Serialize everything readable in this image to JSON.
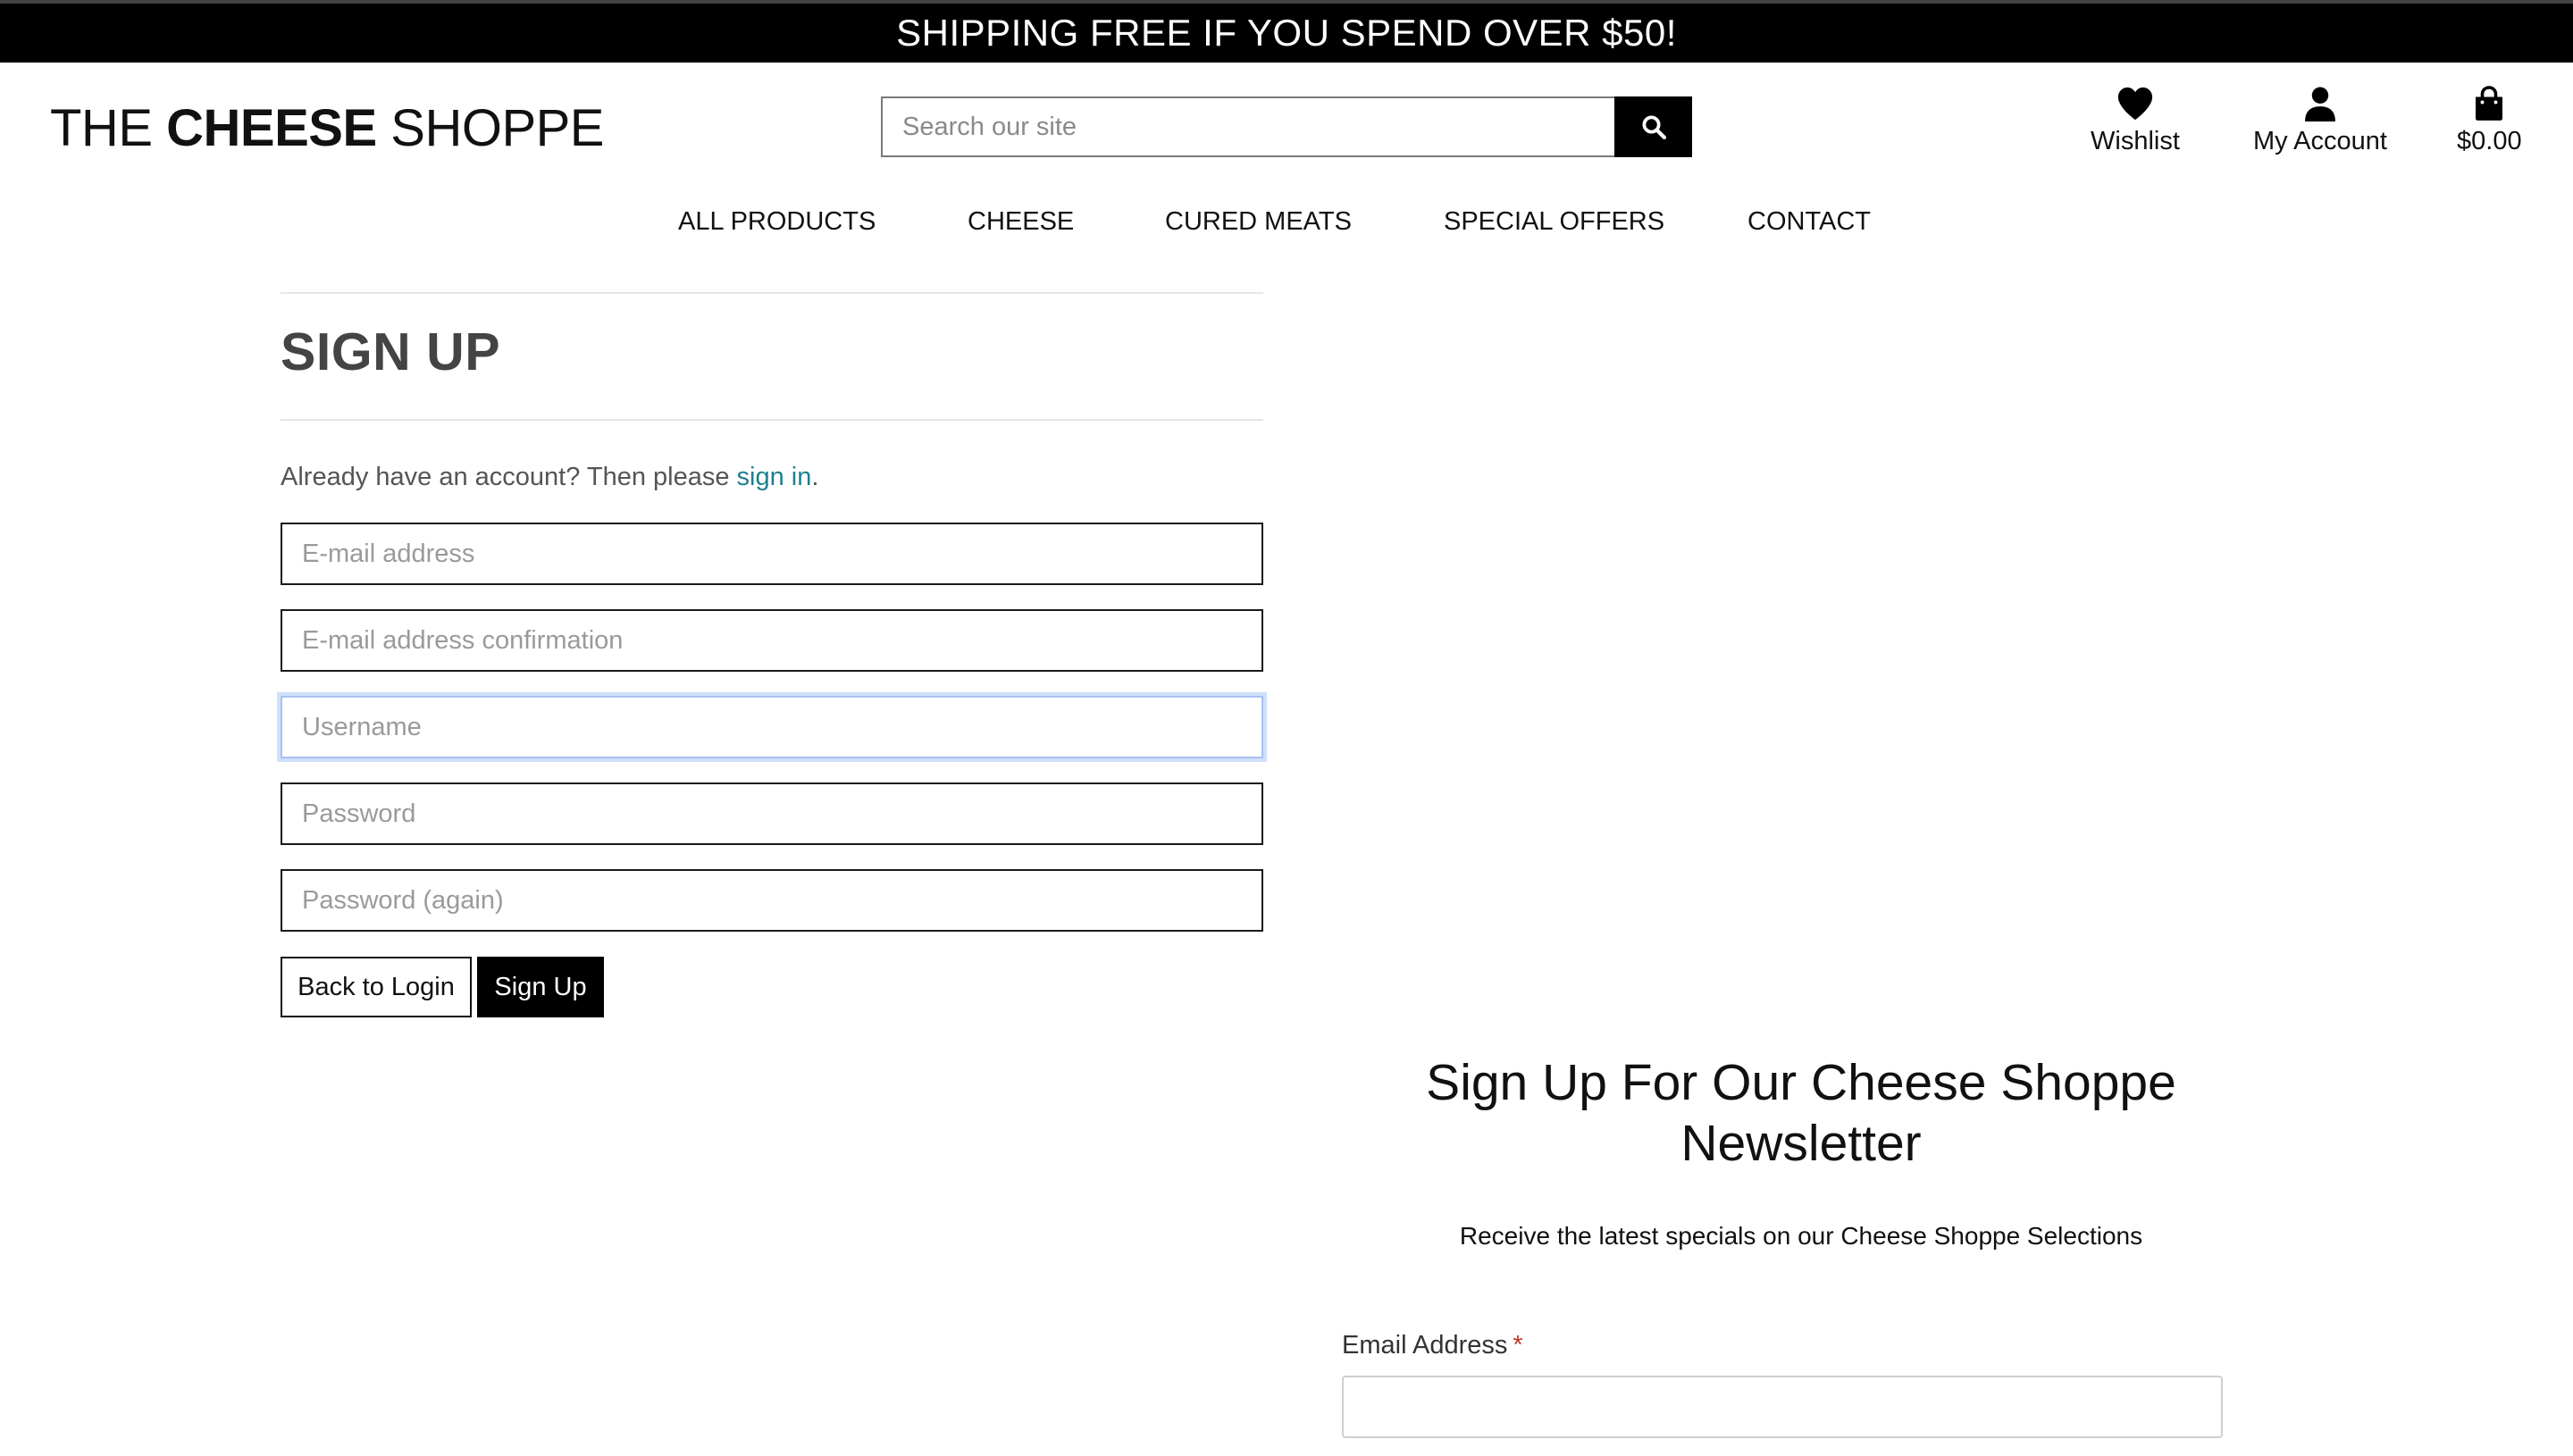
{
  "promo": {
    "text": "SHIPPING FREE IF YOU SPEND OVER $50!"
  },
  "header": {
    "logo_prefix": "THE ",
    "logo_bold": "CHEESE",
    "logo_suffix": " SHOPPE",
    "search": {
      "placeholder": "Search our site",
      "button_icon": "search-icon"
    },
    "wishlist": {
      "label": "Wishlist",
      "icon": "heart-icon"
    },
    "account": {
      "label": "My Account",
      "icon": "user-icon"
    },
    "cart": {
      "label": "$0.00",
      "icon": "shopping-bag-icon"
    }
  },
  "nav": {
    "items": [
      {
        "label": "ALL PRODUCTS"
      },
      {
        "label": "CHEESE"
      },
      {
        "label": "CURED MEATS"
      },
      {
        "label": "SPECIAL OFFERS"
      },
      {
        "label": "CONTACT"
      }
    ]
  },
  "signup": {
    "title": "SIGN UP",
    "already_prefix": "Already have an account? Then please ",
    "signin_link": "sign in",
    "already_suffix": ".",
    "fields": {
      "email": {
        "placeholder": "E-mail address",
        "value": ""
      },
      "email_confirm": {
        "placeholder": "E-mail address confirmation",
        "value": ""
      },
      "username": {
        "placeholder": "Username",
        "value": ""
      },
      "password": {
        "placeholder": "Password",
        "value": ""
      },
      "password_again": {
        "placeholder": "Password (again)",
        "value": ""
      }
    },
    "back_button": "Back to Login",
    "submit_button": "Sign Up"
  },
  "newsletter": {
    "title": "Sign Up For Our Cheese Shoppe Newsletter",
    "subtitle": "Receive the latest specials on our Cheese Shoppe Selections",
    "email_label": "Email Address",
    "required_marker": "*"
  },
  "colors": {
    "link": "#1f7f92",
    "required": "#c0392b",
    "focus_ring": "#cfe0fb"
  }
}
